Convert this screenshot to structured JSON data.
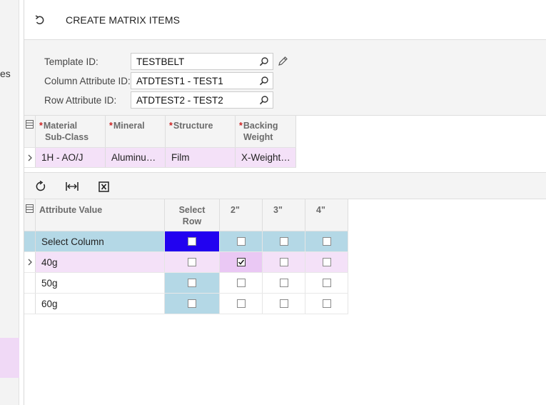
{
  "background": {
    "left_fragment_text": "es"
  },
  "header": {
    "title": "CREATE MATRIX ITEMS"
  },
  "form": {
    "template_id": {
      "label": "Template ID:",
      "value": "TESTBELT"
    },
    "column_attribute_id": {
      "label": "Column Attribute ID:",
      "value": "ATDTEST1 - TEST1"
    },
    "row_attribute_id": {
      "label": "Row Attribute ID:",
      "value": "ATDTEST2 - TEST2"
    }
  },
  "attributes_grid": {
    "columns": [
      {
        "label_line1": "Material",
        "label_line2": "Sub-Class",
        "required": true
      },
      {
        "label_line1": "Mineral",
        "label_line2": "",
        "required": true
      },
      {
        "label_line1": "Structure",
        "label_line2": "",
        "required": true
      },
      {
        "label_line1": "Backing",
        "label_line2": "Weight",
        "required": true
      }
    ],
    "row": [
      "1H - AO/J",
      "Aluminu…",
      "Film",
      "X-Weight…"
    ]
  },
  "matrix_grid": {
    "columns": {
      "attribute_value": "Attribute Value",
      "select_row_line1": "Select",
      "select_row_line2": "Row",
      "values": [
        "2\"",
        "3\"",
        "4\""
      ]
    },
    "select_column_label": "Select Column",
    "rows": [
      {
        "label": "40g",
        "select_row": false,
        "cells": [
          true,
          false,
          false
        ]
      },
      {
        "label": "50g",
        "select_row": false,
        "cells": [
          false,
          false,
          false
        ]
      },
      {
        "label": "60g",
        "select_row": false,
        "cells": [
          false,
          false,
          false
        ]
      }
    ]
  },
  "colors": {
    "selected_row_bg": "#b4d8e6",
    "highlight_row_bg": "#f4e1f8",
    "active_cell_bg": "#2202f0"
  }
}
